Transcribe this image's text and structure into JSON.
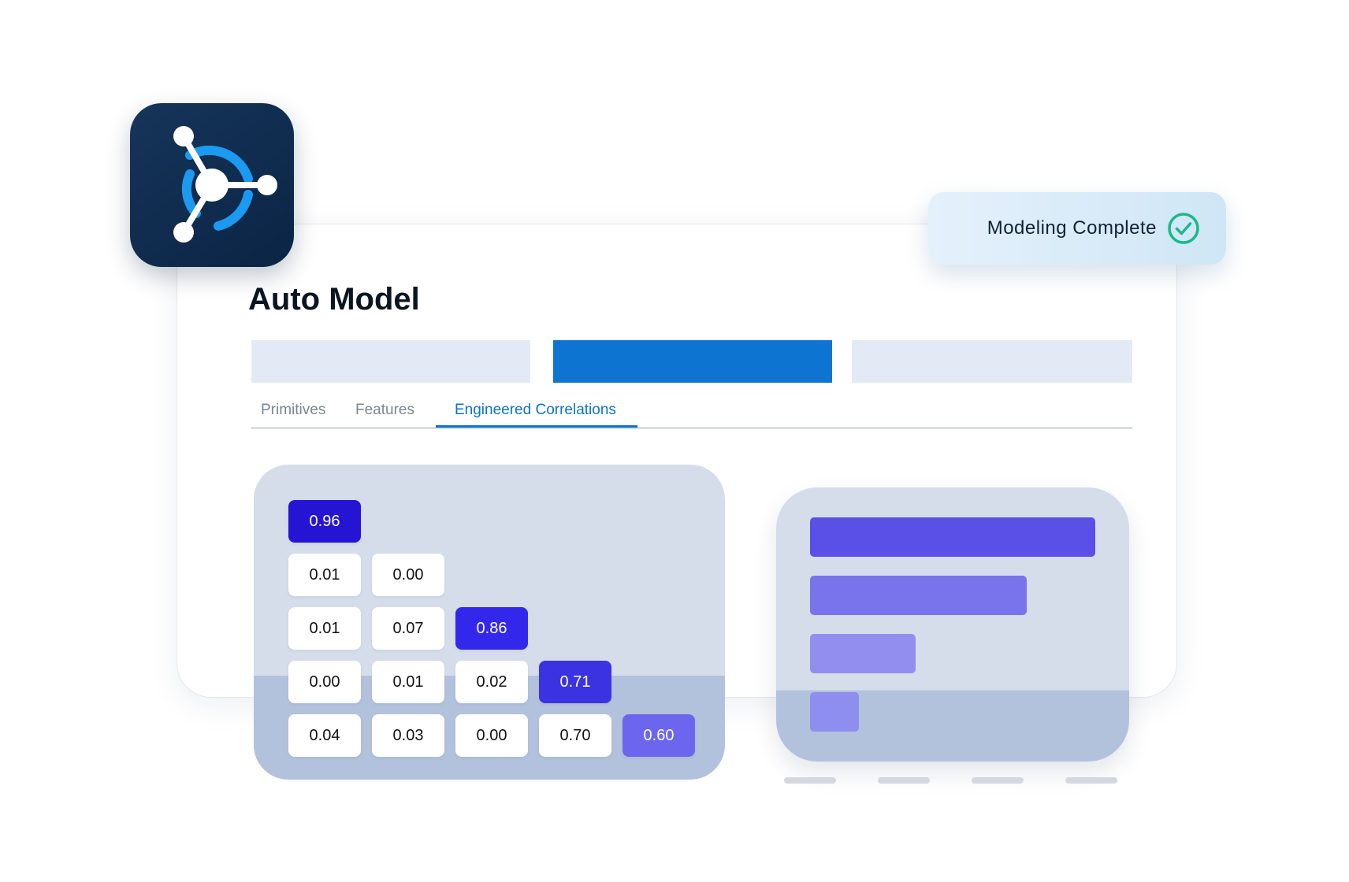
{
  "badge": {
    "text": "Modeling Complete",
    "icon": "check-circle-icon",
    "color": "#19b98a"
  },
  "app": {
    "icon": "network-hub-icon"
  },
  "page": {
    "title": "Auto Model"
  },
  "progress": {
    "steps": 3,
    "active_step": 2,
    "active_color": "#0d74d1"
  },
  "tabs": [
    {
      "label": "Primitives",
      "active": false
    },
    {
      "label": "Features",
      "active": false
    },
    {
      "label": "Engineered Correlations",
      "active": true
    }
  ],
  "correlation_matrix": {
    "rows": [
      [
        "0.96"
      ],
      [
        "0.01",
        "0.00"
      ],
      [
        "0.01",
        "0.07",
        "0.86"
      ],
      [
        "0.00",
        "0.01",
        "0.02",
        "0.71"
      ],
      [
        "0.04",
        "0.03",
        "0.00",
        "0.70",
        "0.60"
      ]
    ],
    "highlight_colors": {
      "0.96": "#2514d4",
      "0.86": "#3427ec",
      "0.71": "#3b33e2",
      "0.70": "#3d37e4",
      "0.60": "#6c66ee"
    }
  },
  "chart_data": {
    "type": "bar",
    "orientation": "horizontal",
    "values": [
      1.0,
      0.76,
      0.37,
      0.17
    ],
    "colors": [
      "#5a50e8",
      "#7a74ec",
      "#928ef0",
      "#8e8df0"
    ],
    "axis_ticks": 4
  }
}
